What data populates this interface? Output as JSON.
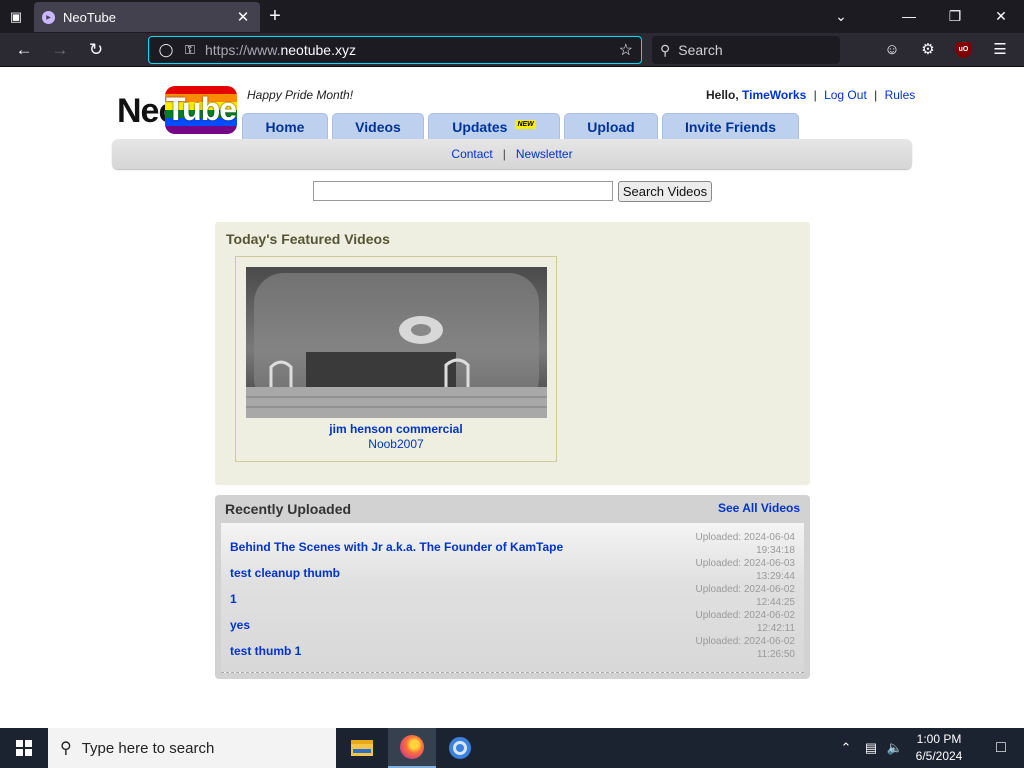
{
  "browser": {
    "tab_title": "NeoTube",
    "url_prefix": "https://www.",
    "url_domain": "neotube.xyz",
    "search_placeholder": "Search"
  },
  "site": {
    "logo_neo": "Neo",
    "logo_tube": "Tube",
    "tagline": "Happy Pride Month!",
    "hello": "Hello,",
    "username": "TimeWorks",
    "logout": "Log Out",
    "rules": "Rules",
    "nav": {
      "home": "Home",
      "videos": "Videos",
      "updates": "Updates",
      "new_badge": "NEW",
      "upload": "Upload",
      "invite": "Invite Friends"
    },
    "subnav": {
      "contact": "Contact",
      "newsletter": "Newsletter"
    },
    "search_button": "Search Videos",
    "search_value": ""
  },
  "featured": {
    "title": "Today's Featured Videos",
    "videos": [
      {
        "title": "jim henson commercial",
        "author": "Noob2007"
      }
    ]
  },
  "recent": {
    "title": "Recently Uploaded",
    "see_all": "See All Videos",
    "items": [
      {
        "title": "Behind The Scenes with Jr a.k.a. The Founder of KamTape",
        "uploaded": "Uploaded: 2024-06-04",
        "time": "19:34:18"
      },
      {
        "title": "test cleanup thumb",
        "uploaded": "Uploaded: 2024-06-03",
        "time": "13:29:44"
      },
      {
        "title": "1",
        "uploaded": "Uploaded: 2024-06-02",
        "time": "12:44:25"
      },
      {
        "title": "yes",
        "uploaded": "Uploaded: 2024-06-02",
        "time": "12:42:11"
      },
      {
        "title": "test thumb 1",
        "uploaded": "Uploaded: 2024-06-02",
        "time": "11:26:50"
      }
    ]
  },
  "taskbar": {
    "search_placeholder": "Type here to search",
    "time": "1:00 PM",
    "date": "6/5/2024"
  },
  "colors": {
    "link": "#0033cc",
    "nav_tab": "#bdd0ee",
    "featured_bg": "#eeefe0",
    "accent_focus": "#00ddff"
  }
}
